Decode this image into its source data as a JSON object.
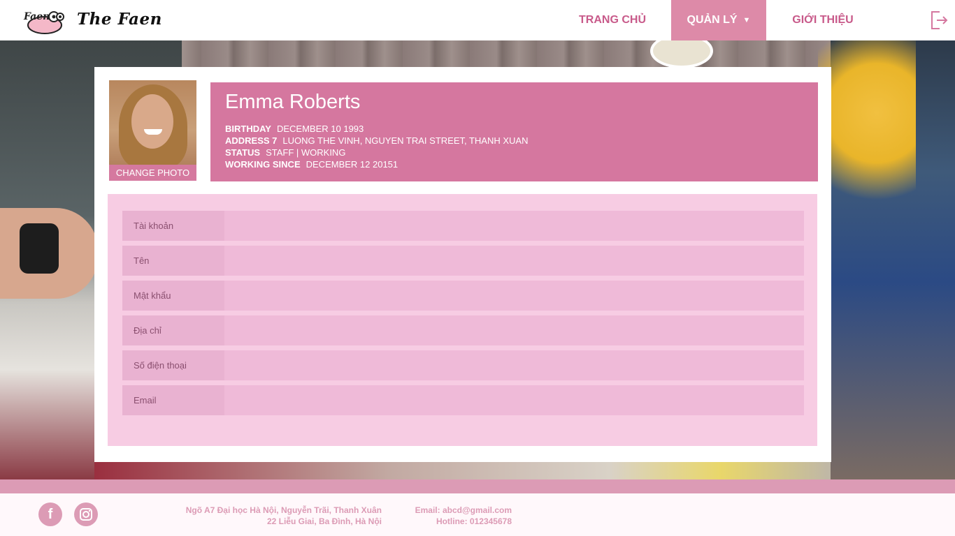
{
  "header": {
    "brand": "The Faen",
    "logo_text": "Faen",
    "nav": [
      {
        "label": "TRANG CHỦ"
      },
      {
        "label": "QUẢN LÝ"
      },
      {
        "label": "GIỚI THIỆU"
      }
    ],
    "active_nav": "QUẢN LÝ",
    "accent_color": "#dd8aa8"
  },
  "profile": {
    "change_photo_label": "CHANGE PHOTO",
    "name": "Emma Roberts",
    "birthday_label": "BIRTHDAY",
    "birthday": "DECEMBER 10 1993",
    "address_label": "ADDRESS 7",
    "address": "LUONG THE VINH, NGUYEN TRAI STREET, THANH XUAN",
    "status_label": "STATUS",
    "status": "STAFF | WORKING",
    "working_since_label": "WORKING SINCE",
    "working_since": "DECEMBER 12 20151",
    "panel_color": "#d5779f"
  },
  "form": {
    "fields": [
      {
        "label": "Tài khoản",
        "value": ""
      },
      {
        "label": "Tên",
        "value": ""
      },
      {
        "label": "Mật khẩu",
        "value": ""
      },
      {
        "label": "Địa chỉ",
        "value": ""
      },
      {
        "label": "Số điện thoại",
        "value": ""
      },
      {
        "label": "Email",
        "value": ""
      }
    ]
  },
  "footer": {
    "social": [
      {
        "icon": "facebook-icon",
        "glyph": "f"
      },
      {
        "icon": "instagram-icon"
      }
    ],
    "address_line1": "Ngõ A7 Đại học Hà Nội, Nguyễn Trãi, Thanh Xuân",
    "address_line2": "22 Liễu Giai, Ba Đình, Hà Nội",
    "email": "Email: abcd@gmail.com",
    "hotline": "Hotline: 012345678",
    "accent_color": "#dc9bb5"
  }
}
